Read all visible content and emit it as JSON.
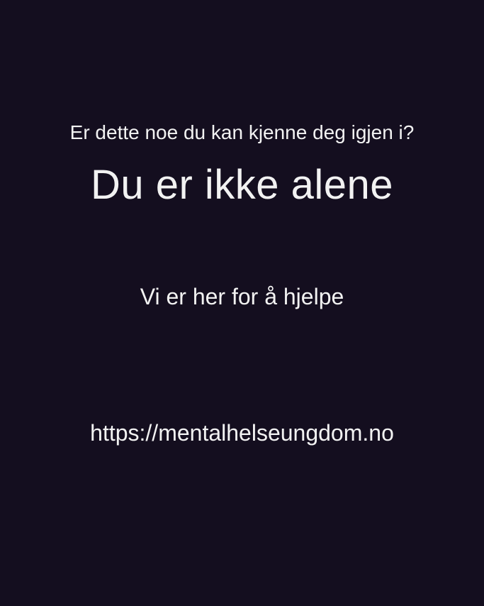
{
  "colors": {
    "background": "#140e1f",
    "text": "#f2f2f2"
  },
  "message": {
    "question": "Er dette noe du kan kjenne deg igjen i?",
    "headline": "Du er ikke alene",
    "help": "Vi er her for å hjelpe",
    "url": "https://mentalhelseungdom.no"
  }
}
